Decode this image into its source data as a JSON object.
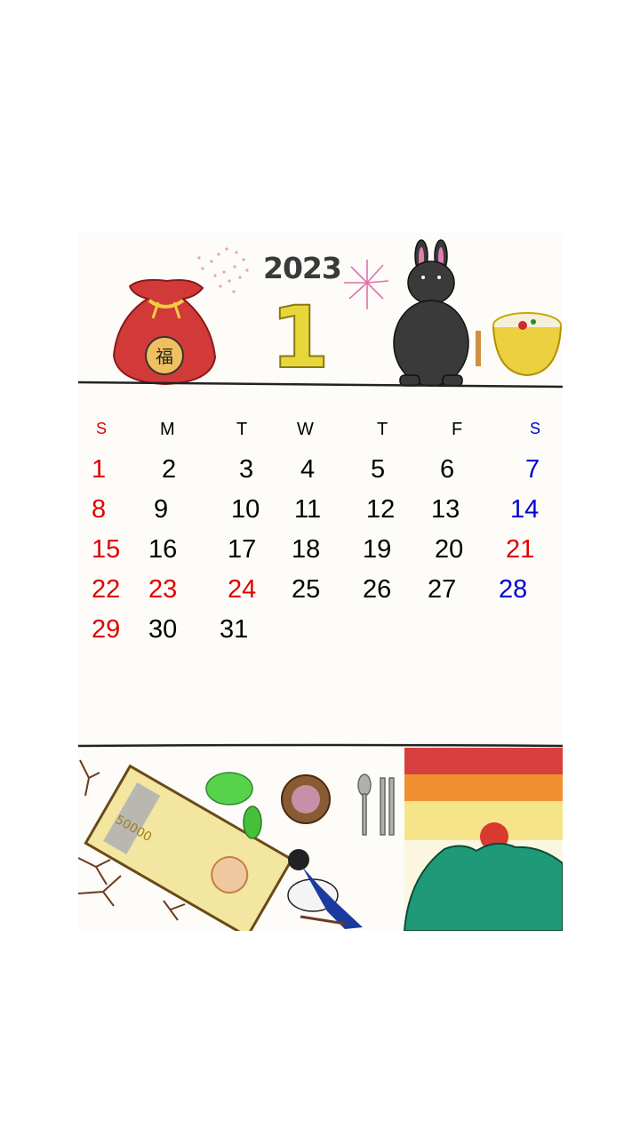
{
  "calendar": {
    "year": "2023",
    "month": "1",
    "weekdays": [
      "S",
      "M",
      "T",
      "W",
      "T",
      "F",
      "S"
    ],
    "weeks": [
      [
        "1",
        "2",
        "3",
        "4",
        "5",
        "6",
        "7"
      ],
      [
        "8",
        "9",
        "10",
        "11",
        "12",
        "13",
        "14"
      ],
      [
        "15",
        "16",
        "17",
        "18",
        "19",
        "20",
        "21"
      ],
      [
        "22",
        "23",
        "24",
        "25",
        "26",
        "27",
        "28"
      ],
      [
        "29",
        "30",
        "31"
      ]
    ]
  },
  "illustration": {
    "bag_character": "福",
    "banknote_value": "50000"
  },
  "colors": {
    "sunday_holiday": "#e00000",
    "saturday": "#0000d0",
    "weekday": "#000000"
  }
}
